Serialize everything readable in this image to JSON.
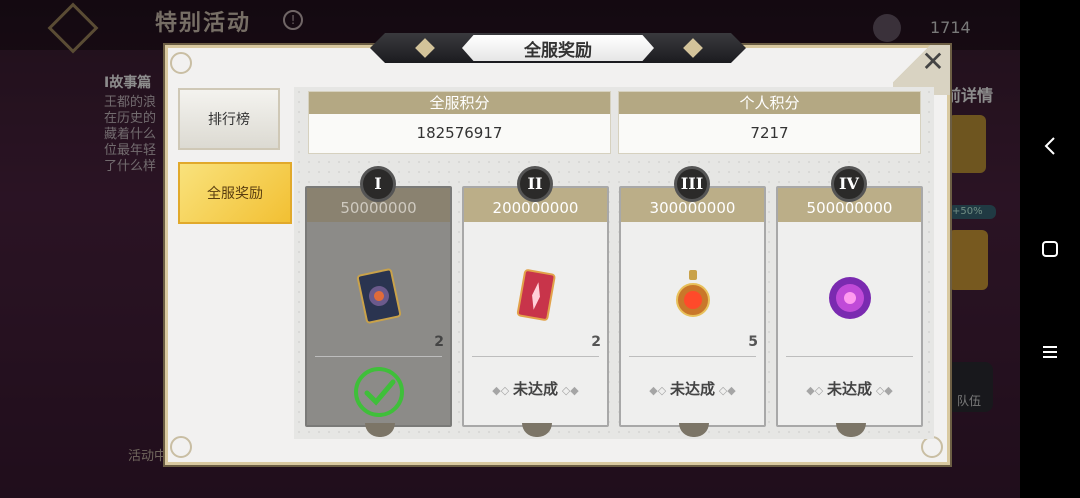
{
  "background": {
    "title": "特别活动",
    "currency": "1714",
    "story_heading": "I故事篇",
    "story_lines": [
      "王都的浪",
      "在历史的",
      "藏着什么",
      "位最年轻",
      "了什么样"
    ],
    "right_label": "前详情",
    "bottom_text": "活动中",
    "bonus_tag": "+50%",
    "team_label": "队伍"
  },
  "modal": {
    "title": "全服奖励",
    "close_label": "✕"
  },
  "tabs": [
    {
      "label": "排行榜",
      "active": false
    },
    {
      "label": "全服奖励",
      "active": true
    }
  ],
  "scores": {
    "server": {
      "label": "全服积分",
      "value": "182576917"
    },
    "personal": {
      "label": "个人积分",
      "value": "7217"
    }
  },
  "rewards": [
    {
      "tier": "I",
      "threshold": "50000000",
      "qty": "2",
      "icon": "card-icon",
      "status": "completed",
      "status_label": ""
    },
    {
      "tier": "II",
      "threshold": "200000000",
      "qty": "2",
      "icon": "red-card-icon",
      "status": "pending",
      "status_label": "未达成"
    },
    {
      "tier": "III",
      "threshold": "300000000",
      "qty": "5",
      "icon": "flame-charm-icon",
      "status": "pending",
      "status_label": "未达成"
    },
    {
      "tier": "IV",
      "threshold": "500000000",
      "qty": "",
      "icon": "purple-orb-icon",
      "status": "pending",
      "status_label": "未达成"
    }
  ],
  "colors": {
    "accent_gold": "#bbae88",
    "tab_active": "#f2c033",
    "check_green": "#3fbf3a"
  }
}
